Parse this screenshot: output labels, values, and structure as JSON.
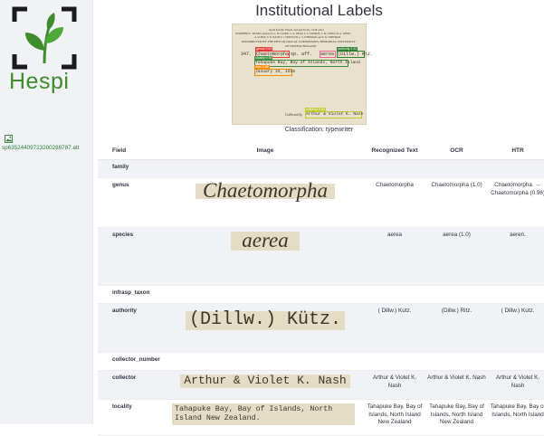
{
  "sidebar": {
    "logo_text": "Hespi",
    "image_icon": "image-icon",
    "filename": "sp63524409723200288787.att"
  },
  "header": {
    "title": "Institutional Labels"
  },
  "specimen": {
    "line1": "South Pacific Plants, Second Series, 1918-1921",
    "line2": "JOSEPHINE E. TILDEN, assisted by C. H. COOKE, L. A. DEAN, T. T. CHURCH, L. M. JONES, M. A. JONES,",
    "line3": "A. SCHUE, V. R. NASH, F. J. FRITZSCH, L. S. WHITMAN, and V. K. WHITMAN",
    "line4": "DISTRIBUTED BY THE PHYCOLOGICAL COMMISSION, MEMORIAL UNIVERSITY",
    "line5": "OF NEWFOUNDLAND",
    "number": "347.",
    "genus": "Chaetomorpha",
    "sp_text": "sp. aff.",
    "species": "aerea",
    "authority": "(Dillw.) Ktz.",
    "locality": "Tahapuke Bay, Bay of Islands, North Island",
    "date": "January 15, 1935",
    "collected_by": "Collected by",
    "collector": "Arthur & Violet K. Nash",
    "tags": {
      "genus": "genus 0.93",
      "species": "species 0.84",
      "authority": "authority 0.91",
      "locality": "locality 0.92",
      "date": "date 0.88",
      "collector": "collector 0.92"
    },
    "colors": {
      "genus": "#e53935",
      "species": "#f06292",
      "authority": "#2e7d32",
      "locality": "#388e3c",
      "date": "#fb8c00",
      "collector": "#c0ca33"
    }
  },
  "caption": "Classification: typewriter",
  "table": {
    "headers": [
      "Field",
      "Image",
      "Recognized Text",
      "OCR",
      "HTR"
    ],
    "rows": [
      {
        "field": "family"
      },
      {
        "field": "genus",
        "image_text": "Chaetomorpha",
        "recognized": "Chaetomorpha",
        "ocr": "Chaetomorpha (1.0)",
        "htr": "Chaetomorpha. → Chaetomorpha (0.96)"
      },
      {
        "field": "species",
        "image_text": "aerea",
        "recognized": "aerea",
        "ocr": "aerea (1.0)",
        "htr": "aeren."
      },
      {
        "field": "infrasp_taxon"
      },
      {
        "field": "authority",
        "image_text": "(Dillw.) Kütz.",
        "recognized": "( Dillw.) Kutz.",
        "ocr": "(Dillw.) Ritz.",
        "htr": "( Dillw.) Kutz."
      },
      {
        "field": "collector_number"
      },
      {
        "field": "collector",
        "image_text": "Arthur & Violet K. Nash",
        "recognized": "Arthur & Violet K. Nash",
        "ocr": "Arthur & Violet K. Nash",
        "htr": "Arthur & Violet K. Nash"
      },
      {
        "field": "locality",
        "image_text": "Tahapuke Bay, Bay of Islands, North Island New Zealand.",
        "recognized": "Tahapuke Bay, Bay of Islands, North Island New Zealand",
        "ocr": "Tahapuke Bay, Bay of Islands, North Island New Zealand",
        "htr": "Tahapuke Bay, Bay of Islands, North Island"
      }
    ]
  }
}
